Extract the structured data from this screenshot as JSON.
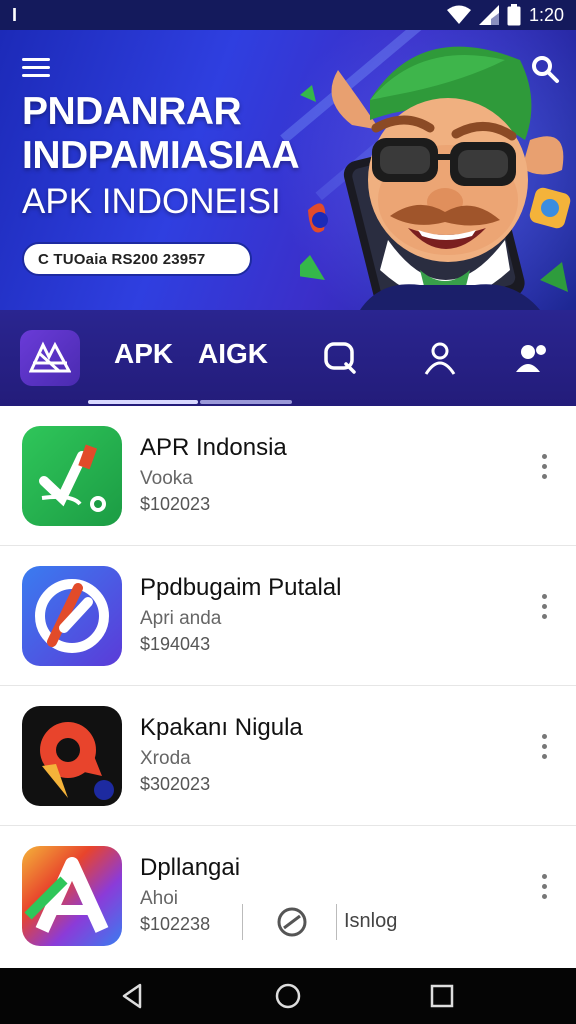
{
  "status_bar": {
    "carrier_glyph": "Ɩ",
    "time": "1:20"
  },
  "hero": {
    "title_line1": "PNDANRAR",
    "title_line2": "INDPAMIASIAA",
    "subtitle": "APK INDONEISI",
    "pill_text": "C TUOaia RS200 23957"
  },
  "nav": {
    "tabs": [
      {
        "label": "APK"
      },
      {
        "label": "AIGK"
      }
    ],
    "accent": "#c9c9ff"
  },
  "apps": [
    {
      "name": "APR Indonsia",
      "developer": "Vooka",
      "price": "$102023",
      "icon": "app-icon-green-check"
    },
    {
      "name": "Ppdbugaim Putalal",
      "developer": "Apri anda",
      "price": "$194043",
      "icon": "app-icon-blue-a"
    },
    {
      "name": "Kpakanı Nigula",
      "developer": "Xroda",
      "price": "$302023",
      "icon": "app-icon-map-pin"
    },
    {
      "name": "Dpllangai",
      "developer": "Ahoi",
      "price": "$102238",
      "icon": "app-icon-rainbow-a",
      "extra_label": "Isnlog"
    }
  ],
  "colors": {
    "hero_bg": "#2a38d8",
    "nav_bg": "#2a2590",
    "list_bg": "#ffffff"
  }
}
